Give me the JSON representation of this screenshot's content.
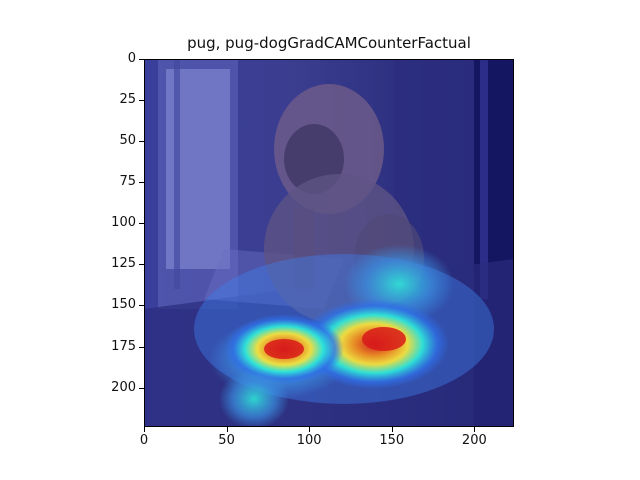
{
  "figure": {
    "title": "pug, pug-dogGradCAMCounterFactual",
    "colors": {
      "overlay_base": "#2a2f8c",
      "heat_cold": "#1b1fb5",
      "heat_mid": "#2ee6d8",
      "heat_warm": "#f6e23b",
      "heat_hot": "#d81a1a"
    },
    "image_description": "bulldog sitting indoors near a window, with GradCAM heatmap overlay concentrated at lower middle-right (a cat-like shape)",
    "x_axis": {
      "ticks": [
        "0",
        "50",
        "100",
        "150",
        "200"
      ],
      "tick_values": [
        0,
        50,
        100,
        150,
        200
      ],
      "range": [
        0,
        224
      ]
    },
    "y_axis": {
      "ticks": [
        "0",
        "25",
        "50",
        "75",
        "100",
        "125",
        "150",
        "175",
        "200"
      ],
      "tick_values": [
        0,
        25,
        50,
        75,
        100,
        125,
        150,
        175,
        200
      ],
      "range": [
        0,
        224
      ]
    }
  }
}
